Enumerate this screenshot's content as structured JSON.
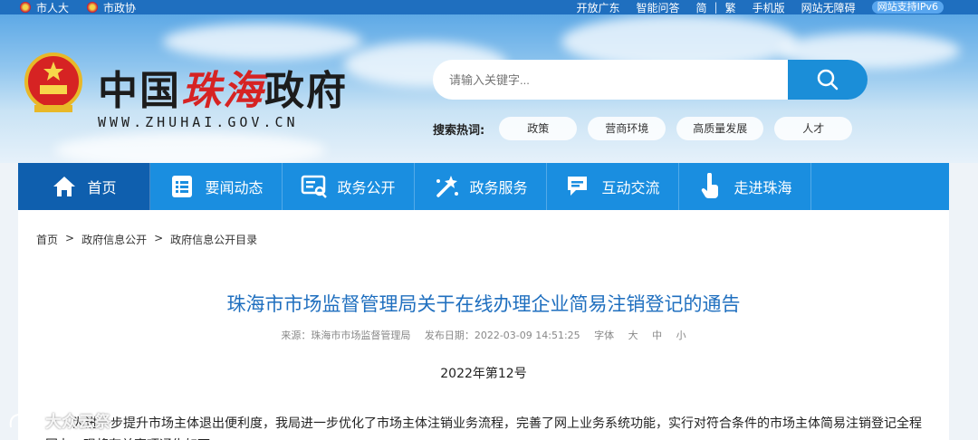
{
  "topbar": {
    "left_links": [
      "市人大",
      "市政协"
    ],
    "right_links": [
      "开放广东",
      "智能问答",
      "简",
      "繁",
      "手机版",
      "网站无障碍"
    ],
    "ipv6": "网站支持IPv6"
  },
  "header": {
    "logo_cn_a": "中国",
    "logo_cn_b": "珠海",
    "logo_cn_c": "政府",
    "logo_en": "WWW.ZHUHAI.GOV.CN",
    "search_placeholder": "请输入关键字...",
    "hot_label": "搜索热词:",
    "hot_tags": [
      "政策",
      "营商环境",
      "高质量发展",
      "人才"
    ]
  },
  "nav": [
    {
      "label": "首页",
      "icon": "home-icon"
    },
    {
      "label": "要闻动态",
      "icon": "news-list-icon"
    },
    {
      "label": "政务公开",
      "icon": "gov-open-icon"
    },
    {
      "label": "政务服务",
      "icon": "service-wand-icon"
    },
    {
      "label": "互动交流",
      "icon": "chat-icon"
    },
    {
      "label": "走进珠海",
      "icon": "hand-pointer-icon"
    }
  ],
  "breadcrumb": [
    "首页",
    ">",
    "政府信息公开",
    ">",
    "政府信息公开目录"
  ],
  "article": {
    "title": "珠海市市场监督管理局关于在线办理企业简易注销登记的通告",
    "source": "来源：珠海市市场监督管理局",
    "date": "发布日期：2022-03-09 14:51:25",
    "font_label": "字体",
    "font_sizes": [
      "大",
      "中",
      "小"
    ],
    "doc_no": "2022年第12号",
    "paragraph": "为进一步提升市场主体退出便利度，我局进一步优化了市场主体注销业务流程，完善了网上业务系统功能，实行对符合条件的市场主体简易注销登记全程网办。现将有关事项通告如下："
  },
  "watermark": "大众云祭",
  "colors": {
    "topbar": "#1f6fbf",
    "nav": "#1a8ee0",
    "nav_active": "#0f5fae",
    "title": "#1f6fbf",
    "accent_red": "#d62323"
  }
}
